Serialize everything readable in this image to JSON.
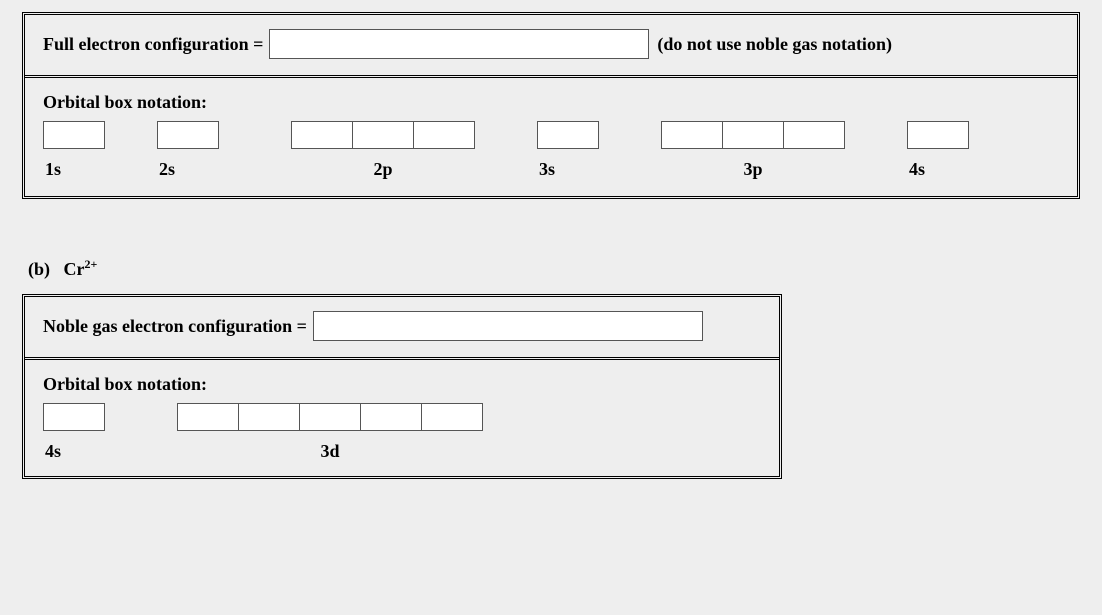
{
  "sectionA": {
    "config_label": "Full electron configuration =",
    "config_value": "",
    "config_hint": "(do not use noble gas notation)",
    "orbital_title": "Orbital box notation:",
    "orbitals": [
      {
        "label": "1s",
        "boxes": [
          ""
        ]
      },
      {
        "label": "2s",
        "boxes": [
          ""
        ]
      },
      {
        "label": "2p",
        "boxes": [
          "",
          "",
          ""
        ]
      },
      {
        "label": "3s",
        "boxes": [
          ""
        ]
      },
      {
        "label": "3p",
        "boxes": [
          "",
          "",
          ""
        ]
      },
      {
        "label": "4s",
        "boxes": [
          ""
        ]
      }
    ]
  },
  "part_b": {
    "marker": "(b)",
    "species_base": "Cr",
    "species_super": "2+"
  },
  "sectionB": {
    "config_label": "Noble gas electron configuration =",
    "config_value": "",
    "orbital_title": "Orbital box notation:",
    "orbitals": [
      {
        "label": "4s",
        "boxes": [
          ""
        ]
      },
      {
        "label": "3d",
        "boxes": [
          "",
          "",
          "",
          "",
          ""
        ]
      }
    ]
  }
}
